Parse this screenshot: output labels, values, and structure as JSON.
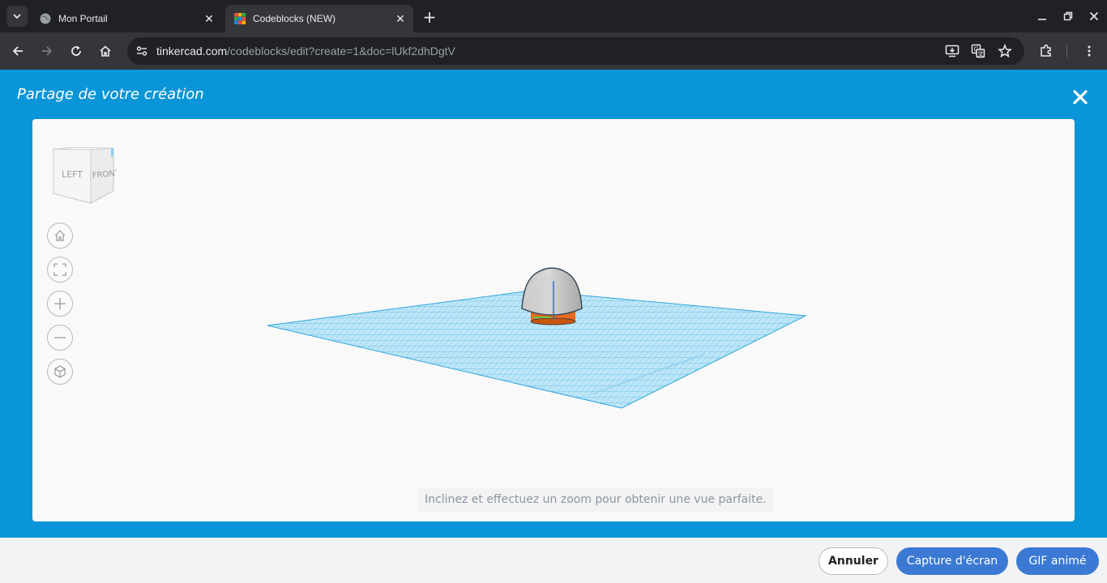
{
  "browser": {
    "tabs": [
      {
        "title": "Mon Portail",
        "active": false
      },
      {
        "title": "Codeblocks (NEW)",
        "active": true
      }
    ],
    "url": {
      "host": "tinkercad.com",
      "path": "/codeblocks/edit?create=1&doc=lUkf2dhDgtV"
    }
  },
  "modal": {
    "title": "Partage de votre création",
    "hint": "Inclinez et effectuez un zoom pour obtenir une vue parfaite.",
    "viewcube": {
      "left": "LEFT",
      "front": "FRONT"
    },
    "view_buttons": [
      "home-view-icon",
      "fit-view-icon",
      "zoom-in-icon",
      "zoom-out-icon",
      "ortho-view-icon"
    ]
  },
  "footer": {
    "cancel_label": "Annuler",
    "screenshot_label": "Capture d'écran",
    "gif_label": "GIF animé"
  },
  "colors": {
    "modal_blue": "#0a95d8",
    "button_blue": "#3b79d4",
    "grid_blue": "#4fb8e6",
    "base_orange": "#e86a1a"
  }
}
